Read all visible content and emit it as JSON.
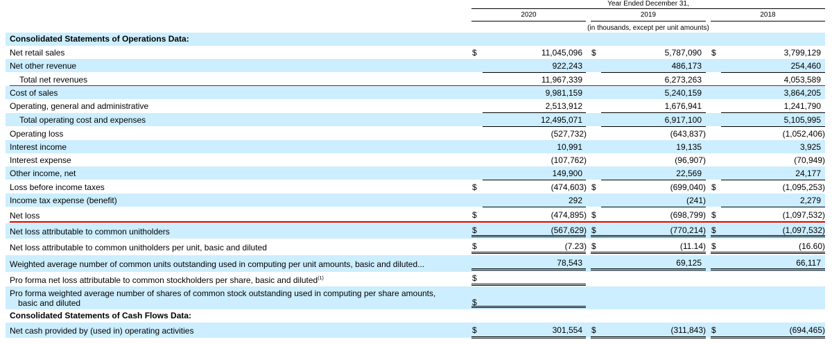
{
  "header": {
    "year_ended": "Year Ended December 31,",
    "col_2020": "2020",
    "col_2019": "2019",
    "col_2018": "2018",
    "units_note": "(in thousands, except per unit amounts)"
  },
  "sections": {
    "operations": "Consolidated Statements of Operations Data:",
    "cash_flows": "Consolidated Statements of Cash Flows Data:"
  },
  "rows": {
    "net_retail_sales": {
      "label": "Net retail sales",
      "d1": "$",
      "v2020": "11,045,096",
      "d2": "$",
      "v2019": "5,787,090",
      "d3": "$",
      "v2018": "3,799,129"
    },
    "net_other_revenue": {
      "label": "Net other revenue",
      "v2020": "922,243",
      "v2019": "486,173",
      "v2018": "254,460"
    },
    "total_net_revenues": {
      "label": "Total net revenues",
      "v2020": "11,967,339",
      "v2019": "6,273,263",
      "v2018": "4,053,589"
    },
    "cost_of_sales": {
      "label": "Cost of sales",
      "v2020": "9,981,159",
      "v2019": "5,240,159",
      "v2018": "3,864,205"
    },
    "opex_ga": {
      "label": "Operating, general and administrative",
      "v2020": "2,513,912",
      "v2019": "1,676,941",
      "v2018": "1,241,790"
    },
    "total_opex": {
      "label": "Total operating cost and expenses",
      "v2020": "12,495,071",
      "v2019": "6,917,100",
      "v2018": "5,105,995"
    },
    "operating_loss": {
      "label": "Operating loss",
      "v2020": "(527,732)",
      "v2019": "(643,837)",
      "v2018": "(1,052,406)"
    },
    "interest_income": {
      "label": "Interest income",
      "v2020": "10,991",
      "v2019": "19,135",
      "v2018": "3,925"
    },
    "interest_expense": {
      "label": "Interest expense",
      "v2020": "(107,762)",
      "v2019": "(96,907)",
      "v2018": "(70,949)"
    },
    "other_income": {
      "label": "Other income, net",
      "v2020": "149,900",
      "v2019": "22,569",
      "v2018": "24,177"
    },
    "loss_before_tax": {
      "label": "Loss before income taxes",
      "d1": "$",
      "v2020": "(474,603)",
      "d2": "$",
      "v2019": "(699,040)",
      "d3": "$",
      "v2018": "(1,095,253)"
    },
    "tax_expense": {
      "label": "Income tax expense (benefit)",
      "v2020": "292",
      "v2019": "(241)",
      "v2018": "2,279"
    },
    "net_loss": {
      "label": "Net loss",
      "d1": "$",
      "v2020": "(474,895)",
      "d2": "$",
      "v2019": "(698,799)",
      "d3": "$",
      "v2018": "(1,097,532)"
    },
    "net_loss_attr": {
      "label": "Net loss attributable to common unitholders",
      "d1": "$",
      "v2020": "(567,629)",
      "d2": "$",
      "v2019": "(770,214)",
      "d3": "$",
      "v2018": "(1,097,532)"
    },
    "net_loss_per_unit": {
      "label": "Net loss attributable to common unitholders per unit, basic and diluted",
      "d1": "$",
      "v2020": "(7.23)",
      "d2": "$",
      "v2019": "(11.14)",
      "d3": "$",
      "v2018": "(16.60)"
    },
    "weighted_units": {
      "label": "Weighted average number of common units outstanding used in computing per unit amounts, basic and diluted...",
      "v2020": "78,543",
      "v2019": "69,125",
      "v2018": "66,117"
    },
    "pro_forma_loss": {
      "label": "Pro forma net loss attributable to common stockholders per share, basic and diluted",
      "sup": "(1)",
      "d1": "$"
    },
    "pro_forma_shares": {
      "label_1": "Pro forma weighted average number of shares of common stock outstanding used in computing per share amounts,",
      "label_2": "basic and diluted",
      "d1": "$"
    },
    "op_cash": {
      "label": "Net cash provided by (used in) operating activities",
      "d1": "$",
      "v2020": "301,554",
      "d2": "$",
      "v2019": "(311,843)",
      "d3": "$",
      "v2018": "(694,465)"
    }
  },
  "colors": {
    "row_shade": "#cceeff",
    "highlight_line": "#d40000"
  }
}
